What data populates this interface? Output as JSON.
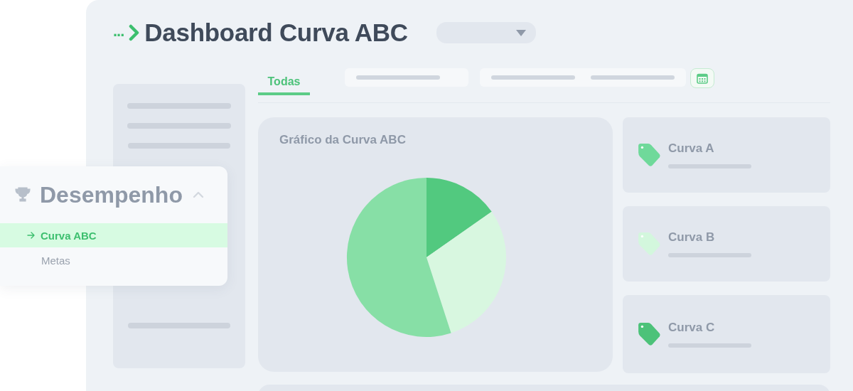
{
  "header": {
    "breadcrumb": "...",
    "title": "Dashboard Curva ABC"
  },
  "tabs": [
    {
      "label": "Todas",
      "selected": true
    }
  ],
  "chart_card": {
    "title": "Gráfico da Curva ABC"
  },
  "curves": [
    {
      "label": "Curva A",
      "color": "#6fd99a"
    },
    {
      "label": "Curva B",
      "color": "#d3f7dd"
    },
    {
      "label": "Curva C",
      "color": "#4cc279"
    }
  ],
  "menu": {
    "title": "Desempenho",
    "expanded": true,
    "items": [
      {
        "label": "Curva ABC",
        "selected": true
      },
      {
        "label": "Metas",
        "selected": false
      }
    ]
  }
}
